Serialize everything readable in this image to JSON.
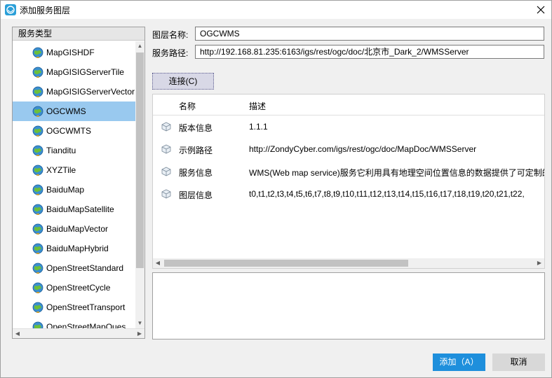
{
  "window": {
    "title": "添加服务图层",
    "icon": "app-globe-icon",
    "close_icon": "close-icon"
  },
  "left_panel": {
    "header": "服务类型",
    "items": [
      {
        "label": "MapGISHDF",
        "icon": "globe-icon",
        "selected": false
      },
      {
        "label": "MapGISIGServerTile",
        "icon": "globe-icon",
        "selected": false
      },
      {
        "label": "MapGISIGServerVector",
        "icon": "globe-icon",
        "selected": false
      },
      {
        "label": "OGCWMS",
        "icon": "globe-icon",
        "selected": true
      },
      {
        "label": "OGCWMTS",
        "icon": "globe-icon",
        "selected": false
      },
      {
        "label": "Tianditu",
        "icon": "globe-icon",
        "selected": false
      },
      {
        "label": "XYZTile",
        "icon": "globe-icon",
        "selected": false
      },
      {
        "label": "BaiduMap",
        "icon": "globe-icon",
        "selected": false
      },
      {
        "label": "BaiduMapSatellite",
        "icon": "globe-icon",
        "selected": false
      },
      {
        "label": "BaiduMapVector",
        "icon": "globe-icon",
        "selected": false
      },
      {
        "label": "BaiduMapHybrid",
        "icon": "globe-icon",
        "selected": false
      },
      {
        "label": "OpenStreetStandard",
        "icon": "globe-icon",
        "selected": false
      },
      {
        "label": "OpenStreetCycle",
        "icon": "globe-icon",
        "selected": false
      },
      {
        "label": "OpenStreetTransport",
        "icon": "globe-icon",
        "selected": false
      },
      {
        "label": "OpenStreetMapQues",
        "icon": "globe-icon",
        "selected": false
      }
    ]
  },
  "form": {
    "layer_name_label": "图层名称:",
    "layer_name_value": "OGCWMS",
    "service_path_label": "服务路径:",
    "service_path_value": "http://192.168.81.235:6163/igs/rest/ogc/doc/北京市_Dark_2/WMSServer"
  },
  "connect_button": "连接(C)",
  "info_table": {
    "headers": {
      "name": "名称",
      "desc": "描述"
    },
    "rows": [
      {
        "name": "版本信息",
        "desc": "1.1.1",
        "icon": "cube-icon"
      },
      {
        "name": "示例路径",
        "desc": "http://ZondyCyber.com/igs/rest/ogc/doc/MapDoc/WMSServer",
        "icon": "cube-icon"
      },
      {
        "name": "服务信息",
        "desc": "WMS(Web map service)服务它利用具有地理空间位置信息的数据提供了可定制的",
        "icon": "cube-icon"
      },
      {
        "name": "图层信息",
        "desc": "t0,t1,t2,t3,t4,t5,t6,t7,t8,t9,t10,t11,t12,t13,t14,t15,t16,t17,t18,t19,t20,t21,t22,",
        "icon": "cube-icon"
      }
    ]
  },
  "buttons": {
    "add": "添加（A）",
    "cancel": "取消"
  },
  "colors": {
    "selection": "#99c9ef",
    "primary_button": "#1e8fdc"
  }
}
